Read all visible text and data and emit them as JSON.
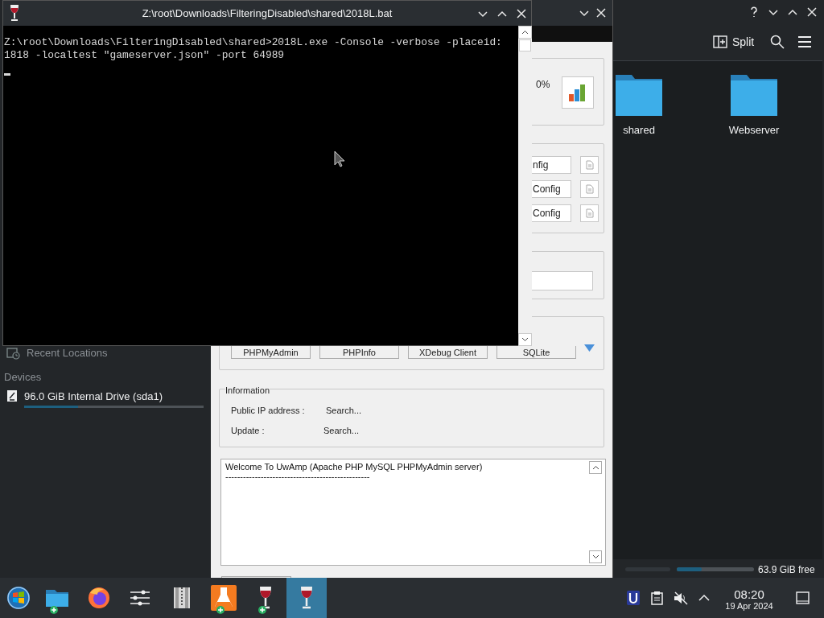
{
  "file_manager": {
    "toolbar": {
      "split_label": "Split"
    },
    "folders": [
      {
        "name": "shared"
      },
      {
        "name": "Webserver"
      }
    ],
    "sidebar": {
      "recent_label": "Recent Locations",
      "sections": [
        {
          "heading": "Devices",
          "items": [
            {
              "label": "96.0 GiB Internal Drive (sda1)",
              "level": 0.3
            }
          ]
        }
      ]
    },
    "status_bar": {
      "free_text": "63.9 GiB free",
      "level": 0.32
    }
  },
  "uwamp": {
    "progress_text": "0%",
    "config_buttons": [
      "nfig",
      "Config",
      "Config"
    ],
    "tool_buttons": [
      "PHPMyAdmin",
      "PHPInfo",
      "XDebug Client",
      "SQLite"
    ],
    "information": {
      "heading": "Information",
      "rows": [
        {
          "label": "Public IP address :",
          "value": "Search..."
        },
        {
          "label": "Update :",
          "value": "Search..."
        }
      ]
    },
    "log_lines": [
      "Welcome To UwAmp (Apache PHP MySQL PHPMyAdmin server)",
      "-------------------------------------------------"
    ]
  },
  "console": {
    "title": "Z:\\root\\Downloads\\FilteringDisabled\\shared\\2018L.bat",
    "lines": [
      "Z:\\root\\Downloads\\FilteringDisabled\\shared>2018L.exe -Console -verbose -placeid:",
      "1818 -localtest \"gameserver.json\" -port 64989"
    ]
  },
  "taskbar": {
    "items": [
      {
        "kind": "start",
        "selected": false,
        "badge": false
      },
      {
        "kind": "folder",
        "selected": false,
        "badge": true
      },
      {
        "kind": "browser",
        "selected": false,
        "badge": false
      },
      {
        "kind": "mixer",
        "selected": false,
        "badge": false
      },
      {
        "kind": "archive",
        "selected": false,
        "badge": false
      },
      {
        "kind": "flask",
        "selected": false,
        "badge": true
      },
      {
        "kind": "wine",
        "selected": false,
        "badge": true
      },
      {
        "kind": "wine",
        "selected": true,
        "badge": false
      }
    ],
    "clock": {
      "time": "08:20",
      "date": "19 Apr 2024"
    }
  }
}
